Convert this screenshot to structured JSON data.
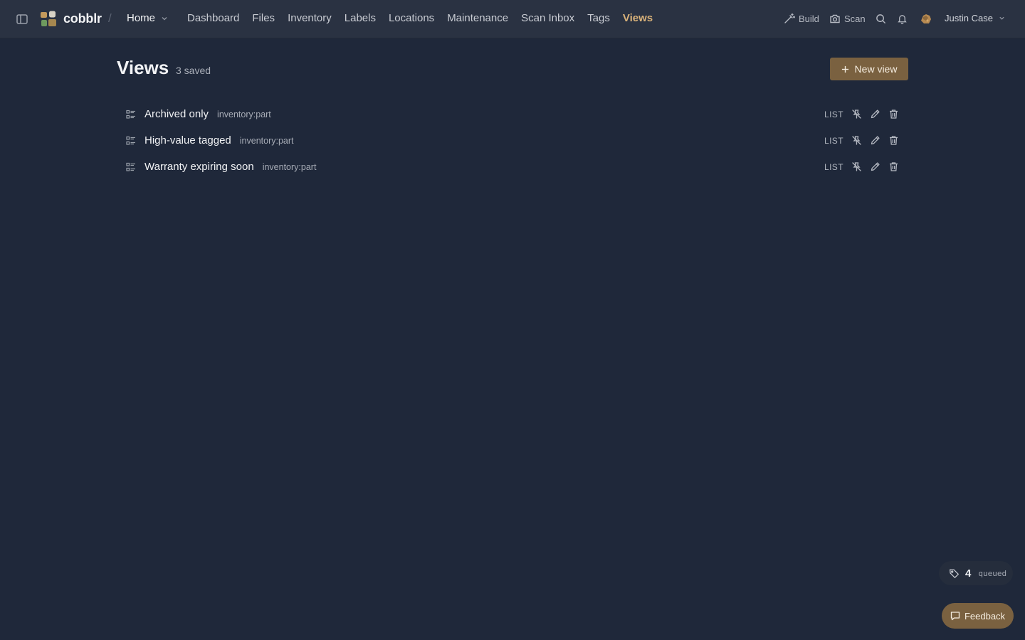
{
  "app": {
    "brand": "cobblr",
    "workspace": "Home"
  },
  "nav": {
    "items": [
      {
        "label": "Dashboard"
      },
      {
        "label": "Files"
      },
      {
        "label": "Inventory"
      },
      {
        "label": "Labels"
      },
      {
        "label": "Locations"
      },
      {
        "label": "Maintenance"
      },
      {
        "label": "Scan Inbox"
      },
      {
        "label": "Tags"
      },
      {
        "label": "Views",
        "active": true
      }
    ]
  },
  "toolbar": {
    "build_label": "Build",
    "scan_label": "Scan",
    "user_name": "Justin Case"
  },
  "page": {
    "title": "Views",
    "count_label": "3 saved",
    "new_button_label": "New view"
  },
  "views": [
    {
      "name": "Archived only",
      "scope": "inventory:part",
      "type": "LIST"
    },
    {
      "name": "High-value tagged",
      "scope": "inventory:part",
      "type": "LIST"
    },
    {
      "name": "Warranty expiring soon",
      "scope": "inventory:part",
      "type": "LIST"
    }
  ],
  "queue": {
    "count": "4",
    "label": "queued"
  },
  "feedback": {
    "label": "Feedback"
  },
  "colors": {
    "background": "#1f283a",
    "topbar": "#2a3242",
    "accent": "#d9b27a",
    "button": "#7a6140"
  },
  "icons": {
    "sidebar_toggle": "sidebar-toggle-icon",
    "build": "magic-wand-icon",
    "scan": "camera-icon",
    "search": "search-icon",
    "notifications": "bell-icon",
    "view": "list-view-icon",
    "unpin": "unpin-icon",
    "edit": "pencil-icon",
    "delete": "trash-icon",
    "queue": "tag-icon",
    "feedback": "chat-bubble-icon"
  }
}
